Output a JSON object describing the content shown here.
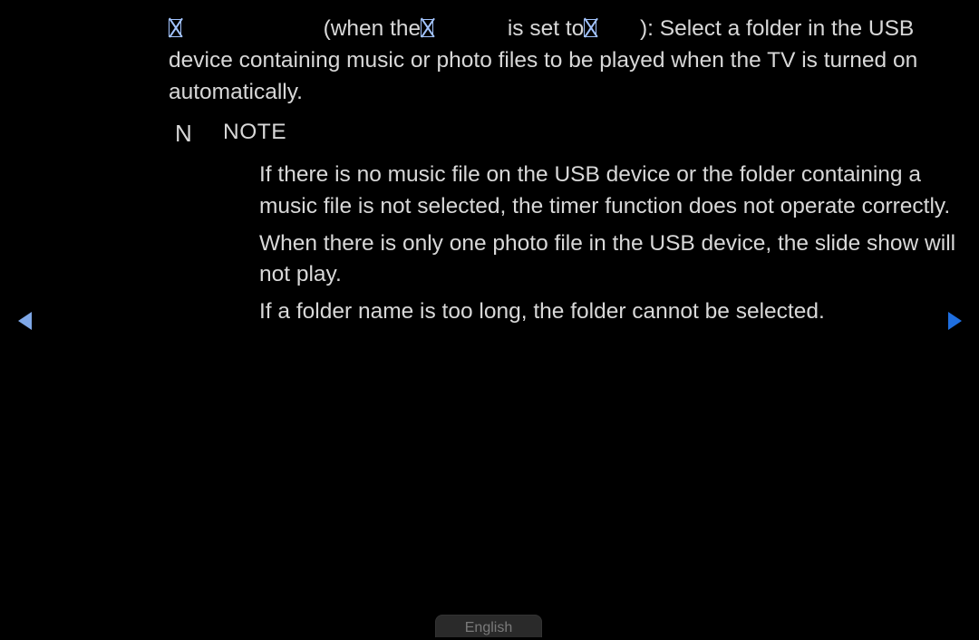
{
  "intro": {
    "seg1": "(when the",
    "seg2": "is set to",
    "seg3": "): Select a folder in the USB device containing music or photo files to be played when the TV is turned on automatically."
  },
  "note": {
    "icon": "N",
    "label": "NOTE",
    "items": [
      "If there is no music file on the USB device or the folder containing a music file is not selected, the timer function does not operate correctly.",
      "When there is only one photo file in the USB device, the slide show will not play.",
      "If a folder name is too long, the folder cannot be selected."
    ]
  },
  "nav": {
    "language": "English"
  }
}
